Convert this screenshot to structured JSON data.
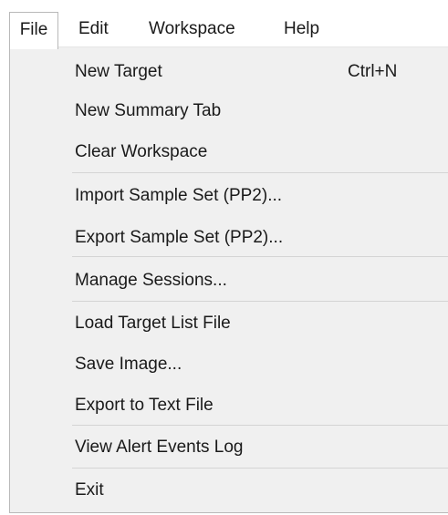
{
  "menubar": {
    "items": [
      "File",
      "Edit",
      "Workspace",
      "Help"
    ],
    "active": "File"
  },
  "file_menu": {
    "groups": [
      [
        {
          "label": "New Target",
          "shortcut": "Ctrl+N"
        },
        {
          "label": "New Summary Tab"
        },
        {
          "label": "Clear Workspace"
        }
      ],
      [
        {
          "label": "Import Sample Set (PP2)..."
        },
        {
          "label": "Export Sample Set (PP2)..."
        }
      ],
      [
        {
          "label": "Manage Sessions..."
        }
      ],
      [
        {
          "label": "Load Target List File"
        },
        {
          "label": "Save Image..."
        },
        {
          "label": "Export to Text File"
        }
      ],
      [
        {
          "label": "View Alert Events Log"
        }
      ],
      [
        {
          "label": "Exit"
        }
      ]
    ]
  },
  "colors": {
    "menu_background": "#f0f0f0",
    "menubar_background": "#ffffff",
    "border": "#b9b9b9",
    "separator": "#d4d4d4",
    "text": "#1a1a1a"
  }
}
